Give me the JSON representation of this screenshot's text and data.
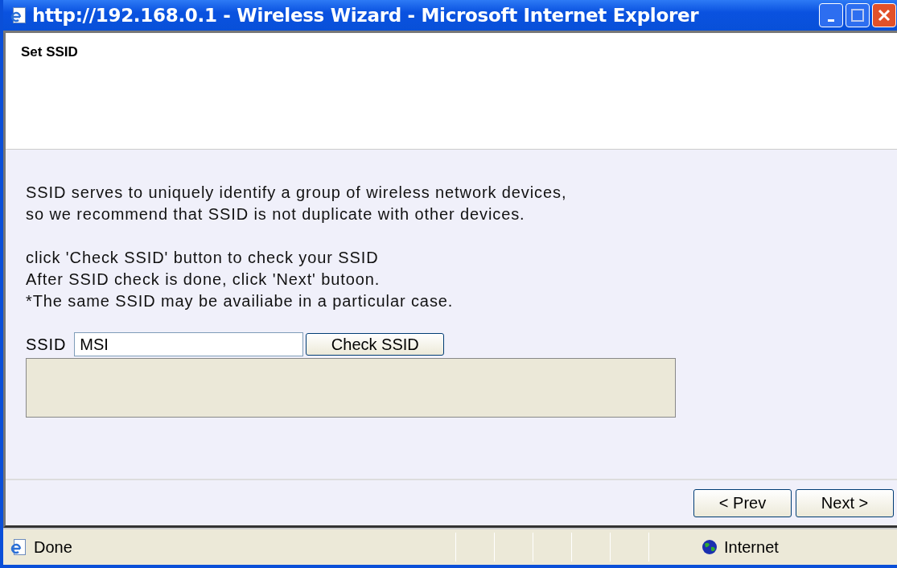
{
  "window": {
    "title": "http://192.168.0.1 - Wireless Wizard - Microsoft Internet Explorer"
  },
  "header": {
    "title": "Set SSID"
  },
  "paragraphs": [
    [
      "SSID serves to uniquely identify a group of wireless network devices,",
      "so we recommend that SSID is not duplicate with other devices."
    ],
    [
      "click 'Check SSID' button to check your SSID",
      "After SSID check is done, click 'Next' butoon.",
      "*The same SSID may be availiabe in a particular case."
    ]
  ],
  "ssid": {
    "label": "SSID",
    "value": "MSI",
    "button": "Check SSID"
  },
  "buttons": [
    "< Prev",
    "Next >"
  ],
  "status_bar": {
    "text": "Done",
    "zone": "Internet"
  }
}
